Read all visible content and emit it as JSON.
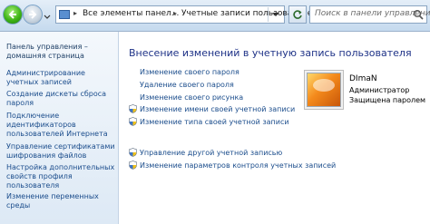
{
  "address": {
    "segments": [
      "Все элементы панел...",
      "Учетные записи пользователей"
    ]
  },
  "search": {
    "placeholder": "Поиск в панели управления"
  },
  "sidebar": {
    "items": [
      "Панель управления – домашняя страница",
      "Администрирование учетных записей",
      "Создание дискеты сброса пароля",
      "Подключение идентификаторов пользователей Интернета",
      "Управление сертификатами шифрования файлов",
      "Настройка дополнительных свойств профиля пользователя",
      "Изменение переменных среды"
    ]
  },
  "main": {
    "title": "Внесение изменений в учетную запись пользователя",
    "tasks": [
      "Изменение своего пароля",
      "Удаление своего пароля",
      "Изменение своего рисунка",
      "Изменение имени своей учетной записи",
      "Изменение типа своей учетной записи"
    ],
    "other_tasks": [
      "Управление другой учетной записью",
      "Изменение параметров контроля учетных записей"
    ]
  },
  "user": {
    "name": "DImaN",
    "role": "Администратор",
    "status": "Защищена паролем"
  },
  "colors": {
    "link": "#1b4d8c",
    "title": "#1e3287",
    "sidebar_bg": "#dde9f5",
    "toolbar_bg": "#c5daee"
  },
  "icons": {
    "shield": "uac-shield-icon",
    "avatar": "user-picture-orange"
  }
}
